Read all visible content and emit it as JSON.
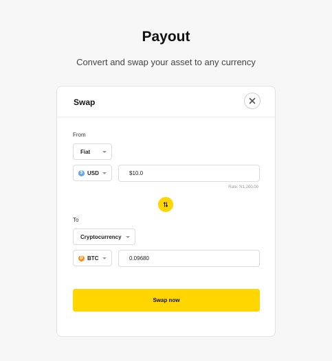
{
  "page": {
    "title": "Payout",
    "subtitle": "Convert and swap your asset to any currency"
  },
  "card": {
    "title": "Swap",
    "close_icon": "close-icon"
  },
  "from": {
    "label": "From",
    "type_select": "Fiat",
    "currency_select": "USD",
    "currency_icon": "dollar-coin-icon",
    "amount": "$10.0",
    "rate": "Rate: N1,200.00"
  },
  "swap_direction_icon": "swap-arrows-icon",
  "to": {
    "label": "To",
    "type_select": "Cryptocurrency",
    "currency_select": "BTC",
    "currency_icon": "bitcoin-icon",
    "amount": "0.09680"
  },
  "action": {
    "swap_label": "Swap now"
  },
  "colors": {
    "accent": "#ffd600",
    "usd_coin": "#6aa8e8",
    "btc_coin": "#f7931a",
    "background": "#f7f7f7"
  }
}
